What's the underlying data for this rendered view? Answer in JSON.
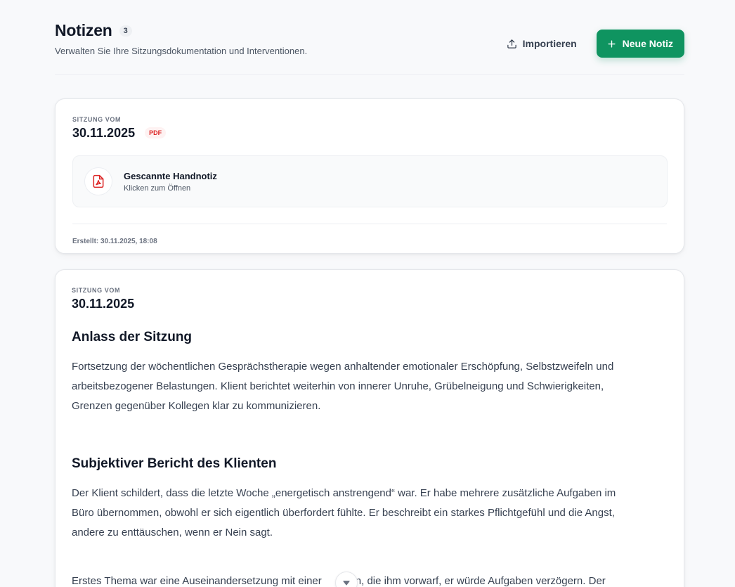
{
  "header": {
    "title": "Notizen",
    "count": "3",
    "subtitle": "Verwalten Sie Ihre Sitzungsdokumentation und Interventionen.",
    "import_label": "Importieren",
    "new_label": "Neue Notiz"
  },
  "notes": [
    {
      "session_label": "SITZUNG VOM",
      "date": "30.11.2025",
      "badge": "PDF",
      "file_title": "Gescannte Handnotiz",
      "file_sub": "Klicken zum Öffnen",
      "created": "Erstellt: 30.11.2025, 18:08"
    },
    {
      "session_label": "SITZUNG VOM",
      "date": "30.11.2025",
      "sections": [
        {
          "heading": "Anlass der Sitzung",
          "lines": [
            "Fortsetzung der wöchentlichen Gesprächstherapie wegen anhaltender emotionaler Erschöpfung, Selbstzweifeln und",
            "arbeitsbezogener Belastungen. Klient berichtet weiterhin von innerer Unruhe, Grübelneigung und Schwierigkeiten,",
            "Grenzen gegenüber Kollegen klar zu kommunizieren."
          ]
        },
        {
          "heading": "Subjektiver Bericht des Klienten",
          "lines": [
            "Der Klient schildert, dass die letzte Woche „energetisch anstrengend“ war. Er habe mehrere zusätzliche Aufgaben im",
            "Büro übernommen, obwohl er sich eigentlich überfordert fühlte. Er beschreibt ein starkes Pflichtgefühl und die Angst,",
            "andere zu enttäuschen, wenn er Nein sagt."
          ],
          "extra_line_left": "Erstes Thema war eine Auseinandersetzung mit einer",
          "extra_line_right": "egin, die ihm vorwarf, er würde Aufgaben verzögern. Der"
        }
      ]
    }
  ],
  "colors": {
    "accent": "#0f9460",
    "pdf_red": "#dc2626",
    "background": "#f8f9fb"
  },
  "icons": [
    "upload-icon",
    "plus-icon",
    "pdf-file-icon",
    "chevron-down-icon"
  ]
}
